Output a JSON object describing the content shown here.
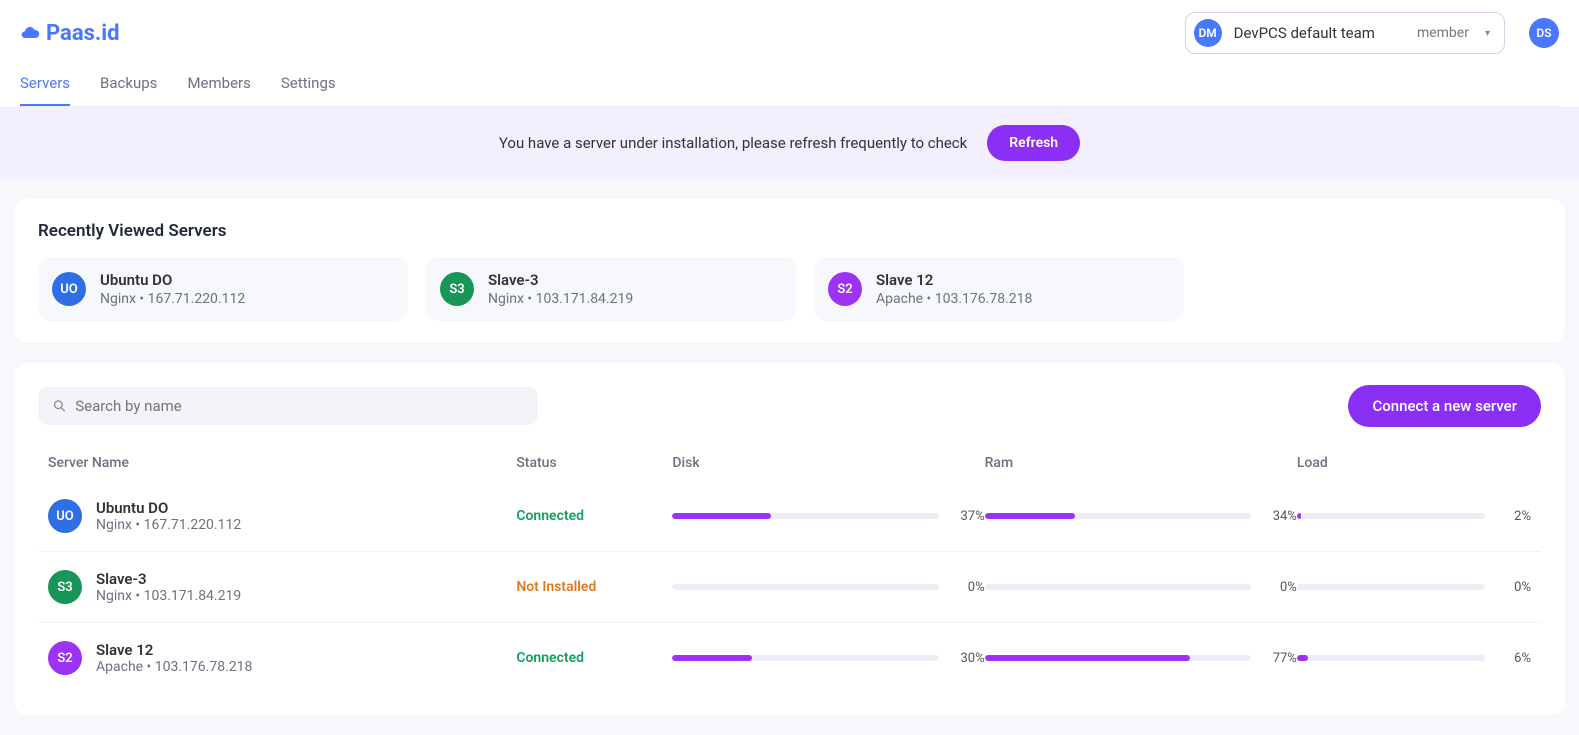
{
  "brand": "Paas.id",
  "team_selector": {
    "badge": "DM",
    "name": "DevPCS default team",
    "role": "member"
  },
  "user_avatar": "DS",
  "tabs": [
    "Servers",
    "Backups",
    "Members",
    "Settings"
  ],
  "active_tab": 0,
  "notice": {
    "text": "You have a server under installation, please refresh frequently to check",
    "button": "Refresh"
  },
  "recent_title": "Recently Viewed Servers",
  "recent": [
    {
      "badge": "UO",
      "color": "c-blue",
      "name": "Ubuntu DO",
      "stack": "Nginx",
      "ip": "167.71.220.112"
    },
    {
      "badge": "S3",
      "color": "c-green",
      "name": "Slave-3",
      "stack": "Nginx",
      "ip": "103.171.84.219"
    },
    {
      "badge": "S2",
      "color": "c-purple",
      "name": "Slave 12",
      "stack": "Apache",
      "ip": "103.176.78.218"
    }
  ],
  "search_placeholder": "Search by name",
  "connect_button": "Connect a new server",
  "columns": {
    "name": "Server Name",
    "status": "Status",
    "disk": "Disk",
    "ram": "Ram",
    "load": "Load"
  },
  "rows": [
    {
      "badge": "UO",
      "color": "c-blue",
      "name": "Ubuntu DO",
      "stack": "Nginx",
      "ip": "167.71.220.112",
      "status": "Connected",
      "status_class": "status-connected",
      "disk": 37,
      "ram": 34,
      "load": 2
    },
    {
      "badge": "S3",
      "color": "c-green",
      "name": "Slave-3",
      "stack": "Nginx",
      "ip": "103.171.84.219",
      "status": "Not Installed",
      "status_class": "status-notinstalled",
      "disk": 0,
      "ram": 0,
      "load": 0
    },
    {
      "badge": "S2",
      "color": "c-purple",
      "name": "Slave 12",
      "stack": "Apache",
      "ip": "103.176.78.218",
      "status": "Connected",
      "status_class": "status-connected",
      "disk": 30,
      "ram": 77,
      "load": 6
    }
  ]
}
